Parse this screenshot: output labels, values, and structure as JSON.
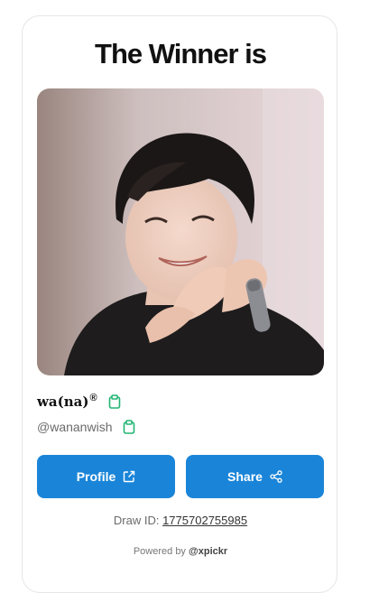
{
  "title": "The Winner is",
  "winner": {
    "name": "wa(na)",
    "name_mark": "®",
    "handle": "@wananwish"
  },
  "buttons": {
    "profile_label": "Profile",
    "share_label": "Share"
  },
  "draw": {
    "label": "Draw ID: ",
    "id": "1775702755985"
  },
  "footer": {
    "prefix": "Powered by ",
    "brand": "@xpickr"
  },
  "colors": {
    "button": "#1a85d8",
    "copy_icon": "#22b573"
  },
  "icons": {
    "copy": "clipboard-icon",
    "profile": "external-link-icon",
    "share": "share-icon"
  }
}
